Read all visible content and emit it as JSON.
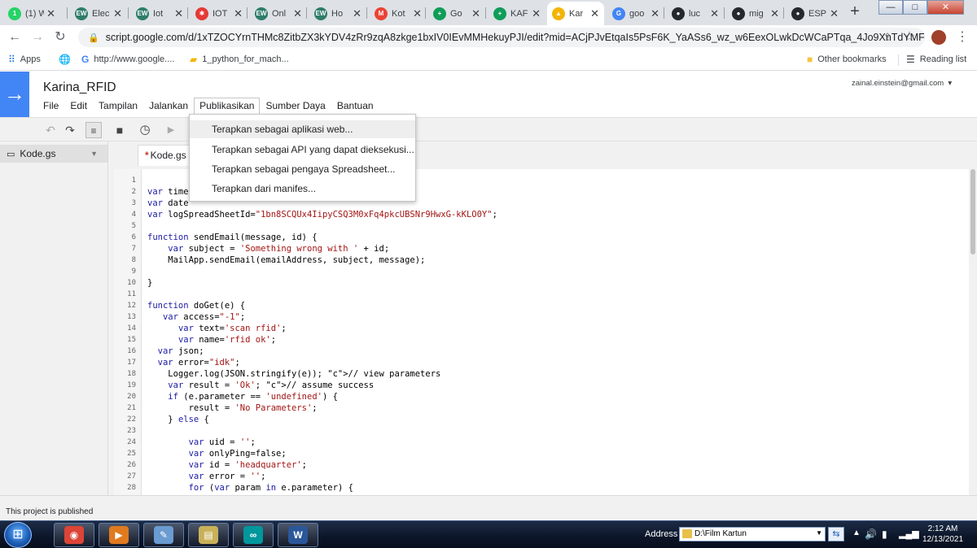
{
  "browser": {
    "tabs": [
      {
        "title": "(1) W",
        "fav_text": "1",
        "fav_color": "#25d366",
        "icon": "whatsapp-icon"
      },
      {
        "title": "Elec",
        "fav_text": "EW",
        "fav_color": "#2e7d6b",
        "icon": "ew-icon"
      },
      {
        "title": "Iot",
        "fav_text": "EW",
        "fav_color": "#2e7d6b",
        "icon": "ew-icon"
      },
      {
        "title": "IOT",
        "fav_text": "✱",
        "fav_color": "#e53935",
        "icon": "iot-icon"
      },
      {
        "title": "Onl",
        "fav_text": "EW",
        "fav_color": "#2e7d6b",
        "icon": "ew-icon"
      },
      {
        "title": "Ho",
        "fav_text": "EW",
        "fav_color": "#2e7d6b",
        "icon": "ew-icon"
      },
      {
        "title": "Kot",
        "fav_text": "M",
        "fav_color": "#ea4335",
        "icon": "gmail-icon"
      },
      {
        "title": "Go",
        "fav_text": "+",
        "fav_color": "#0f9d58",
        "icon": "sheets-icon"
      },
      {
        "title": "KAF",
        "fav_text": "+",
        "fav_color": "#0f9d58",
        "icon": "sheets-icon"
      },
      {
        "title": "Kar",
        "fav_text": "▲",
        "fav_color": "#f4b400",
        "icon": "apps-script-icon",
        "active": true
      },
      {
        "title": "goo",
        "fav_text": "G",
        "fav_color": "#4285f4",
        "icon": "google-icon"
      },
      {
        "title": "luc",
        "fav_text": "●",
        "fav_color": "#24292e",
        "icon": "github-icon"
      },
      {
        "title": "mig",
        "fav_text": "●",
        "fav_color": "#24292e",
        "icon": "github-icon"
      },
      {
        "title": "ESP",
        "fav_text": "●",
        "fav_color": "#24292e",
        "icon": "github-icon"
      }
    ],
    "new_tab_label": "+",
    "window_buttons": {
      "minimize": "—",
      "maximize": "□",
      "close": "✕"
    },
    "url": "script.google.com/d/1xTZOCYrnTHMc8ZitbZX3kYDV4zRr9zqA8zkge1bxIV0IEvMMHekuyPJI/edit?mid=ACjPJvEtqaIs5PsF6K_YaASs6_wz_w6EexOLwkDcWCaPTqa_4Jo9XnTdYMF1...",
    "bookmarks": [
      {
        "label": "Apps",
        "icon": "apps-grid-icon"
      },
      {
        "label": "",
        "icon": "globe-icon"
      },
      {
        "label": "http://www.google....",
        "icon": "google-icon"
      },
      {
        "label": "1_python_for_mach...",
        "icon": "bookmark-doc-icon"
      }
    ],
    "other_bookmarks": "Other bookmarks",
    "reading_list": "Reading list"
  },
  "app": {
    "title": "Karina_RFID",
    "account": "zainal.einstein@gmail.com",
    "menus": [
      "File",
      "Edit",
      "Tampilan",
      "Jalankan",
      "Publikasikan",
      "Sumber Daya",
      "Bantuan"
    ],
    "open_menu_index": 4,
    "dropdown_items": [
      "Terapkan sebagai aplikasi web...",
      "Terapkan sebagai API yang dapat dieksekusi...",
      "Terapkan sebagai pengaya Spreadsheet...",
      "Terapkan dari manifes..."
    ],
    "highlighted_item_index": 0,
    "file_list": [
      {
        "name": "Kode.gs"
      }
    ],
    "editor_tab": {
      "modified_marker": "*",
      "name": "Kode.gs"
    },
    "status": "This project is published",
    "accent_color": "#4285f4"
  },
  "code": {
    "line_numbers": [
      "1",
      "2",
      "3",
      "4",
      "5",
      "6",
      "7",
      "8",
      "9",
      "10",
      "11",
      "12",
      "13",
      "14",
      "15",
      "16",
      "17",
      "18",
      "19",
      "20",
      "21",
      "22",
      "23",
      "24",
      "25",
      "26",
      "27",
      "28"
    ],
    "lines": [
      "",
      "var time",
      "var date",
      "var logSpreadSheetId=\"1bn8SCQUx4IipyCSQ3M0xFq4pkcUBSNr9HwxG-kKLO0Y\";",
      "",
      "function sendEmail(message, id) {",
      "    var subject = 'Something wrong with ' + id;",
      "    MailApp.sendEmail(emailAddress, subject, message);",
      "",
      "}",
      "",
      "function doGet(e) {",
      "   var access=\"-1\";",
      "      var text='scan rfid';",
      "      var name='rfid ok';",
      "  var json;",
      "  var error=\"idk\";",
      "    Logger.log(JSON.stringify(e)); // view parameters",
      "    var result = 'Ok'; // assume success",
      "    if (e.parameter == 'undefined') {",
      "        result = 'No Parameters';",
      "    } else {",
      "",
      "        var uid = '';",
      "        var onlyPing=false;",
      "        var id = 'headquarter';",
      "        var error = '';",
      "        for (var param in e.parameter) {"
    ]
  },
  "taskbar": {
    "start_label": "⊞",
    "apps": [
      {
        "name": "chrome",
        "glyph": "◉",
        "color": "#db4437"
      },
      {
        "name": "media-player",
        "glyph": "▶",
        "color": "#e07a1f"
      },
      {
        "name": "paint",
        "glyph": "✎",
        "color": "#6a9bd1"
      },
      {
        "name": "scanner",
        "glyph": "▤",
        "color": "#c9b15a"
      },
      {
        "name": "arduino",
        "glyph": "∞",
        "color": "#00979d"
      },
      {
        "name": "word",
        "glyph": "W",
        "color": "#2b579a"
      }
    ],
    "address_label": "Address",
    "address_value": "D:\\Film Kartun",
    "time": "2:12 AM",
    "date": "12/13/2021"
  }
}
